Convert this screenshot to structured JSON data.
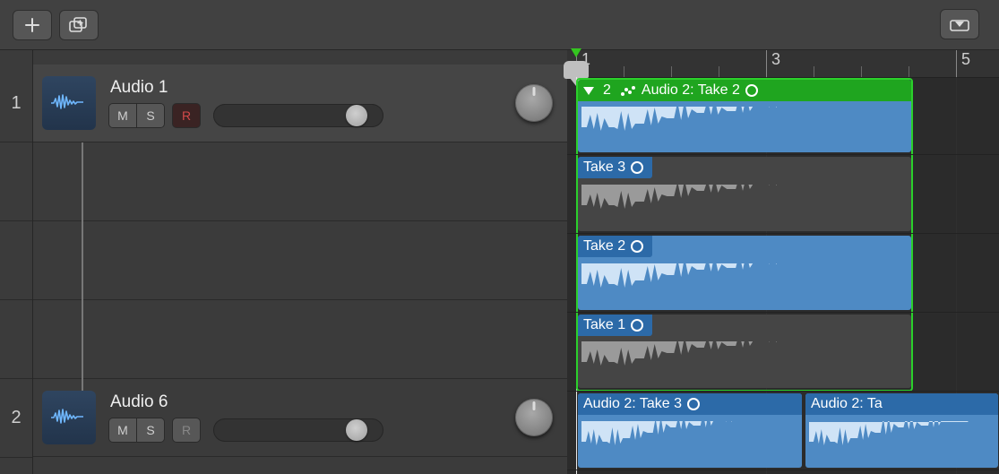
{
  "ruler": {
    "marks": [
      "1",
      "3",
      "5"
    ]
  },
  "tracks": [
    {
      "num": "1",
      "name": "Audio 1",
      "mute": "M",
      "solo": "S",
      "rec": "R",
      "rec_armed": true
    },
    {
      "num": "2",
      "name": "Audio 6",
      "mute": "M",
      "solo": "S",
      "rec": "R",
      "rec_armed": false
    }
  ],
  "take_folder": {
    "header": {
      "take_selector": "2",
      "label": "Audio 2: Take 2"
    },
    "takes": [
      {
        "label": "Take 3",
        "selected": false
      },
      {
        "label": "Take 2",
        "selected": true
      },
      {
        "label": "Take 1",
        "selected": false
      }
    ]
  },
  "track2_regions": [
    {
      "label": "Audio 2: Take 3"
    },
    {
      "label": "Audio 2: Ta"
    }
  ],
  "colors": {
    "accent_green": "#1fa51f",
    "region_blue": "#4e8ac4",
    "region_header_blue": "#2c6aa8"
  }
}
